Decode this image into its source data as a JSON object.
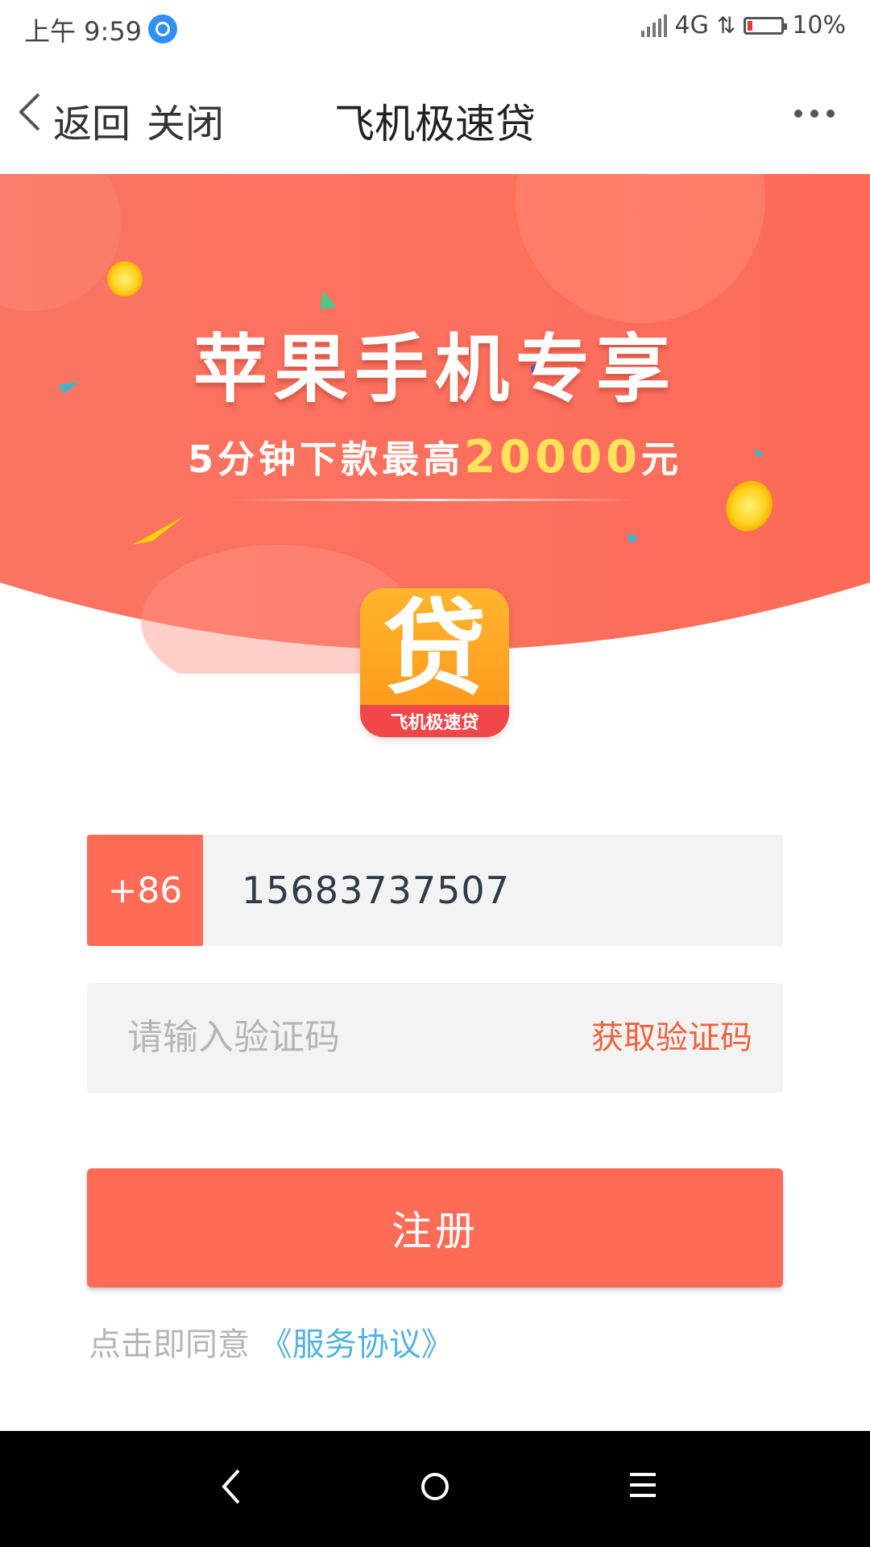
{
  "status_bar": {
    "time": "上午 9:59",
    "network": "4G",
    "battery": "10%",
    "battery_level": 0.1
  },
  "nav": {
    "back_label": "返回",
    "close_label": "关闭",
    "title": "飞机极速贷"
  },
  "banner": {
    "title": "苹果手机专享",
    "subtitle_prefix": "5分钟下款最高",
    "subtitle_amount": "20000",
    "subtitle_suffix": "元"
  },
  "app_logo": {
    "glyph": "贷",
    "name": "飞机极速贷"
  },
  "form": {
    "country_code": "+86",
    "phone": "15683737507",
    "code_placeholder": "请输入验证码",
    "get_code_label": "获取验证码",
    "register_label": "注册"
  },
  "agreement": {
    "prefix": "点击即同意",
    "link": "《服务协议》"
  },
  "colors": {
    "accent": "#fe6c58",
    "link": "#56b2e0",
    "banner": "#fb6f5c",
    "highlight": "#ffe15a"
  }
}
